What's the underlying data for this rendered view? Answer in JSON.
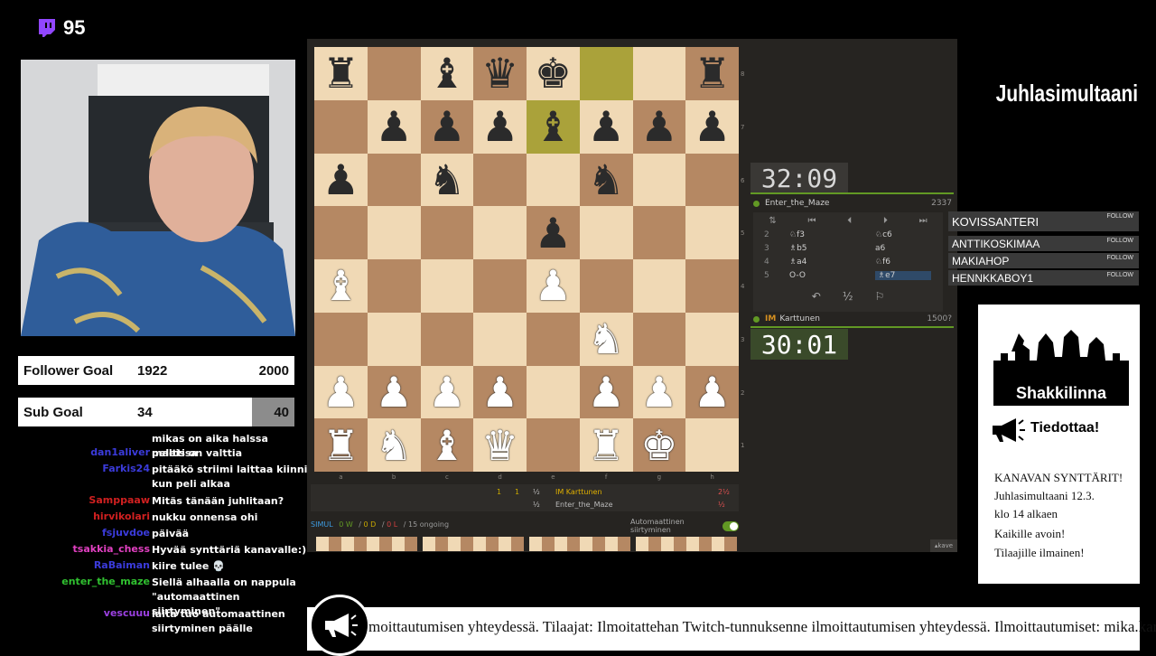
{
  "viewer_count": "95",
  "goals": {
    "follower": {
      "label": "Follower Goal",
      "current": "1922",
      "target": "2000"
    },
    "sub": {
      "label": "Sub Goal",
      "current": "34",
      "target": "40"
    }
  },
  "chat": [
    {
      "user": "",
      "message": "mikas on aika halssa peleissa",
      "color": "#4a6cf0"
    },
    {
      "user": "dan1aliver",
      "message": "maltti on valttia",
      "color": "#3b3bdb"
    },
    {
      "user": "Farkis24",
      "message": "pitääkö striimi laittaa kiinni kun peli alkaa",
      "color": "#3b3bdb"
    },
    {
      "user": "Samppaaw",
      "message": "Mitäs tänään juhlitaan?",
      "color": "#d02020"
    },
    {
      "user": "hirvikolari",
      "message": "nukku onnensa ohi",
      "color": "#d02020"
    },
    {
      "user": "fsjuvdoe",
      "message": "päivää",
      "color": "#3b3bdb"
    },
    {
      "user": "tsakkia_chess",
      "message": "Hyvää synttäriä kanavalle:)",
      "color": "#e040c0"
    },
    {
      "user": "RaBaiman",
      "message": "kiire tulee 💀",
      "color": "#3b3bdb"
    },
    {
      "user": "enter_the_maze",
      "message": "Siellä alhaalla on nappula \"automaattinen siirtyminen\"",
      "color": "#30c030"
    },
    {
      "user": "vescuuu",
      "message": "laita tuo automaattinen siirtyminen päälle",
      "color": "#9b40e0"
    }
  ],
  "board": {
    "files": [
      "a",
      "b",
      "c",
      "d",
      "e",
      "f",
      "g",
      "h"
    ],
    "ranks": [
      "8",
      "7",
      "6",
      "5",
      "4",
      "3",
      "2",
      "1"
    ],
    "rows": [
      [
        "br",
        "",
        "bb",
        "bq",
        "bk",
        "",
        "",
        "br"
      ],
      [
        "",
        "bp",
        "bp",
        "bp",
        "bb",
        "bp",
        "bp",
        "bp"
      ],
      [
        "bp",
        "",
        "bn",
        "",
        "",
        "bn",
        "",
        ""
      ],
      [
        "",
        "",
        "",
        "",
        "bp",
        "",
        "",
        ""
      ],
      [
        "wb",
        "",
        "",
        "",
        "wp",
        "",
        "",
        ""
      ],
      [
        "",
        "",
        "",
        "",
        "",
        "wn",
        "",
        ""
      ],
      [
        "wp",
        "wp",
        "wp",
        "wp",
        "",
        "wp",
        "wp",
        "wp"
      ],
      [
        "wr",
        "wn",
        "wb",
        "wq",
        "",
        "wr",
        "wk",
        ""
      ]
    ],
    "highlight": [
      "e7",
      "f8"
    ]
  },
  "clocks": {
    "top": "32:09",
    "bottom": "30:01"
  },
  "players": {
    "top": {
      "name": "Enter_the_Maze",
      "rating": "2337"
    },
    "bottom": {
      "title": "IM",
      "name": "Karttunen",
      "rating": "1500?"
    }
  },
  "moves": [
    {
      "num": "2",
      "white": "♘f3",
      "black": "♘c6"
    },
    {
      "num": "3",
      "white": "♗b5",
      "black": "a6"
    },
    {
      "num": "4",
      "white": "♗a4",
      "black": "♘f6"
    },
    {
      "num": "5",
      "white": "O-O",
      "black": "♗e7"
    }
  ],
  "move_actions": {
    "draw": "½"
  },
  "result_bar": {
    "row1": {
      "s1": "1",
      "s2": "1",
      "s3": "½",
      "player": "IM Karttunen",
      "score": "2½"
    },
    "row2": {
      "s3": "½",
      "player": "Enter_the_Maze",
      "score": "½"
    }
  },
  "simul": {
    "label": "SIMUL",
    "wins": "0 W",
    "draws": "0 D",
    "losses": "0 L",
    "ongoing": "15 ongoing",
    "auto_label": "Automaattinen siirtyminen"
  },
  "stream_title": "Juhlasimultaani",
  "followers": [
    {
      "name": "KOVISSANTERI",
      "tag": "FOLLOW"
    },
    {
      "name": "ANTTIKOSKIMAA",
      "tag": "FOLLOW"
    },
    {
      "name": "MAKIAHOP",
      "tag": "FOLLOW"
    },
    {
      "name": "HENNKKABOY1",
      "tag": "FOLLOW"
    }
  ],
  "announcement": {
    "logo": "Shakkilinna",
    "header": "Tiedottaa!",
    "lines": [
      "KANAVAN SYNTTÄRIT!",
      "Juhlasimultaani 12.3.",
      "klo 14 alkaen",
      "Kaikille avoin!",
      "Tilaajille ilmainen!"
    ]
  },
  "ticker": "moittautumisen yhteydessä. Tilaajat: Ilmoitattehan Twitch-tunnuksenne ilmoittautumisen yhteydessä. Ilmoittautumiset: mika.karttunen",
  "ext_button": "kave",
  "colors": {
    "light_square": "#f0d9b5",
    "dark_square": "#b58863",
    "highlight": "#cdd26a",
    "accent_green": "#629924"
  }
}
